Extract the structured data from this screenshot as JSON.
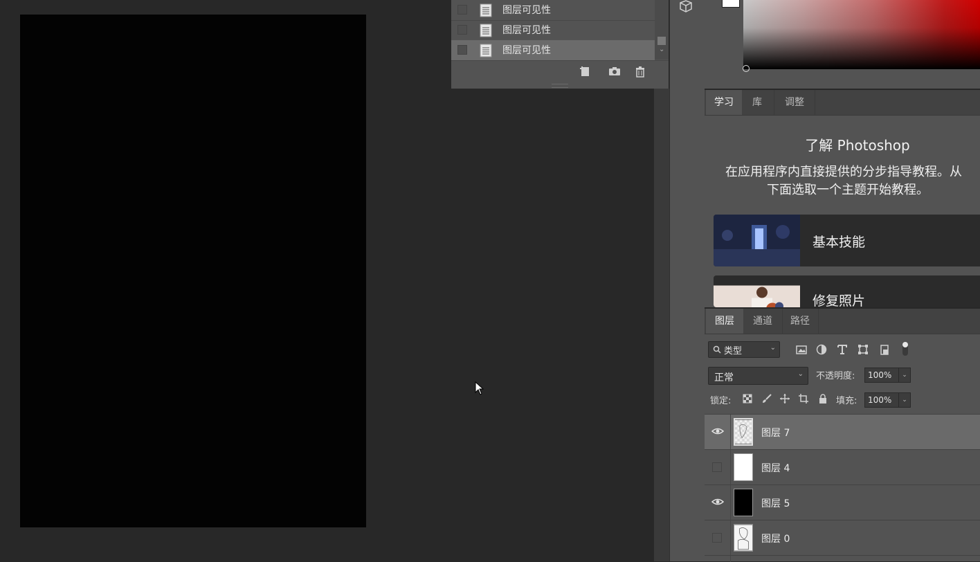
{
  "history": {
    "items": [
      {
        "label": "图层可见性"
      },
      {
        "label": "图层可见性"
      },
      {
        "label": "图层可见性"
      }
    ],
    "selected_index": 2,
    "footer_icons": [
      "new-document-from-state-icon",
      "camera-icon",
      "trash-icon"
    ]
  },
  "learn_panel": {
    "tabs": [
      {
        "label": "学习",
        "active": true
      },
      {
        "label": "库",
        "active": false
      },
      {
        "label": "调整",
        "active": false
      }
    ],
    "title": "了解 Photoshop",
    "description_line1": "在应用程序内直接提供的分步指导教程。从",
    "description_line2": "下面选取一个主题开始教程。",
    "cards": [
      {
        "label": "基本技能"
      },
      {
        "label": "修复照片"
      }
    ]
  },
  "layers_panel": {
    "tabs": [
      {
        "label": "图层",
        "active": true
      },
      {
        "label": "通道",
        "active": false
      },
      {
        "label": "路径",
        "active": false
      }
    ],
    "filter_kind": "类型",
    "blend_mode": "正常",
    "opacity_label": "不透明度:",
    "opacity_value": "100%",
    "lock_label": "锁定:",
    "fill_label": "填充:",
    "fill_value": "100%",
    "layers": [
      {
        "name": "图层 7",
        "visible": true,
        "selected": true,
        "thumb": "sketch"
      },
      {
        "name": "图层 4",
        "visible": false,
        "selected": false,
        "thumb": "white"
      },
      {
        "name": "图层 5",
        "visible": true,
        "selected": false,
        "thumb": "black"
      },
      {
        "name": "图层 0",
        "visible": false,
        "selected": false,
        "thumb": "sketch"
      }
    ]
  },
  "colors": {
    "app_bg": "#282828",
    "panel_bg": "#535353",
    "canvas": "#030303",
    "spectrum_accent": "#d00000"
  }
}
